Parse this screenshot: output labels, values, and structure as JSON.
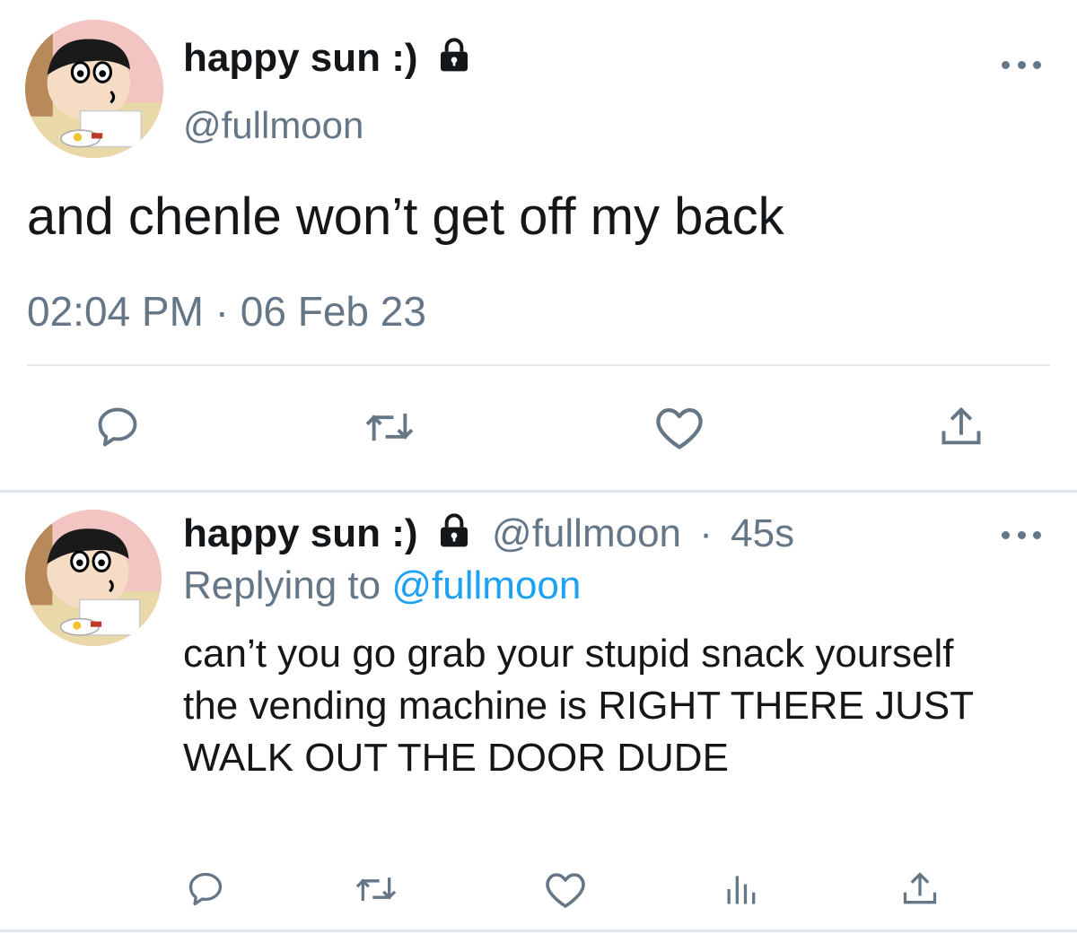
{
  "tweet": {
    "display_name": "happy sun :)",
    "handle": "@fullmoon",
    "text": "and chenle won’t get off my back",
    "timestamp": "02:04 PM · 06 Feb 23",
    "avatar_icon": "cartoon-avatar-icon",
    "protected_icon": "lock-icon",
    "actions": [
      "reply-icon",
      "retweet-icon",
      "like-icon",
      "share-icon"
    ]
  },
  "reply": {
    "display_name": "happy sun :)",
    "handle": "@fullmoon",
    "age": "45s",
    "replying_prefix": "Replying to",
    "replying_to": "@fullmoon",
    "text": "can’t you go grab your stupid snack yourself the vending machine is RIGHT THERE JUST WALK OUT THE DOOR DUDE",
    "actions": [
      "reply-icon",
      "retweet-icon",
      "like-icon",
      "analytics-icon",
      "share-icon"
    ]
  },
  "colors": {
    "text": "#14171a",
    "secondary": "#657786",
    "link": "#1da1f2",
    "divider": "#e1e8ed"
  }
}
